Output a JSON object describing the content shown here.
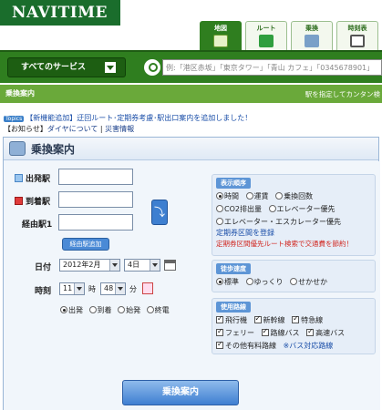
{
  "header": {
    "logo": "NAVITIME",
    "tabs": [
      {
        "label": "地図",
        "icon": "home-map-icon",
        "active": true
      },
      {
        "label": "ルート",
        "icon": "route-icon",
        "active": false
      },
      {
        "label": "乗換",
        "icon": "train-icon",
        "active": false
      },
      {
        "label": "時刻表",
        "icon": "clock-icon",
        "active": false
      }
    ],
    "services_label": "すべてのサービス",
    "search_placeholder": "例:「港区赤坂」「東京タワー」「青山 カフェ」「0345678901」"
  },
  "subbar": {
    "title": "乗換案内",
    "right_text": "駅を指定してカンタン検"
  },
  "topics": {
    "badge": "Topics",
    "text": "【新機能追加】迂回ルート･定期券考慮･駅出口案内を追加しました！"
  },
  "notice": {
    "prefix": "【お知らせ】",
    "link1": "ダイヤについて",
    "sep": " | ",
    "link2": "災害情報"
  },
  "panel": {
    "title": "乗換案内",
    "departure_label": "出発駅",
    "arrival_label": "到着駅",
    "via_label": "経由駅1",
    "swap_symbol": "⤵",
    "add_via_button": "経由駅追加",
    "date_label": "日付",
    "year_month": "2012年2月",
    "day": "4日",
    "time_label": "時刻",
    "hour": "11",
    "hour_unit": "時",
    "minute": "48",
    "minute_unit": "分",
    "time_modes": [
      "出発",
      "到着",
      "始発",
      "終電"
    ],
    "selected_time_mode": "出発",
    "search_button": "乗換案内"
  },
  "display_order": {
    "header": "表示順序",
    "options": [
      "時間",
      "運賃",
      "乗換回数",
      "CO2排出量",
      "エレベーター優先",
      "エレベーター・エスカレーター優先"
    ],
    "selected": "時間",
    "link": "定期券区間を登録",
    "warning": "定期券区間優先ルート検索で交通費を節約！"
  },
  "walk_speed": {
    "header": "徒歩速度",
    "options": [
      "標準",
      "ゆっくり",
      "せかせか"
    ],
    "selected": "標準"
  },
  "routes": {
    "header": "使用路線",
    "items": [
      "飛行機",
      "新幹線",
      "特急線",
      "フェリー",
      "路線バス",
      "高速バス",
      "その他有料路線"
    ],
    "link": "※バス対応路線"
  }
}
